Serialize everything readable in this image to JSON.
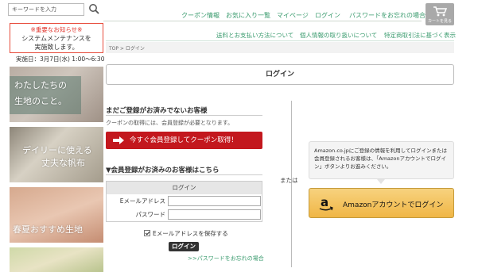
{
  "search": {
    "placeholder": "キーワードを入力"
  },
  "topnav": {
    "items": [
      "クーポン情報",
      "お気に入り一覧",
      "マイページ",
      "ログイン",
      "パスワードをお忘れの場合"
    ],
    "cart_label": "カートを見る"
  },
  "subnav": {
    "items": [
      "送料とお支払い方法について",
      "個人情報の取り扱いについて",
      "特定商取引法に基づく表示"
    ]
  },
  "breadcrumb": "TOP > ログイン",
  "notice": {
    "title": "※重要なお知らせ※",
    "line1": "システムメンテナンスを",
    "line2": "実施致します。",
    "date": "実施日：3月7日(水) 1:00〜6:30"
  },
  "banners": {
    "b1_line1": "わたしたちの",
    "b1_line2": "生地のこと。",
    "b2_line1": "デイリーに使える",
    "b2_line2": "丈夫な帆布",
    "b3_text": "春夏おすすめ生地"
  },
  "login": {
    "heading": "ログイン",
    "new_title": "まだご登録がお済みでないお客様",
    "new_desc": "クーポンの取得には、会員登録が必要となります。",
    "register_button": "今すぐ会員登録してクーポン取得！",
    "member_title": "▼会員登録がお済みのお客様はこちら",
    "form_header": "ログイン",
    "email_label": "Eメールアドレス",
    "password_label": "パスワード",
    "remember_label": "Eメールアドレスを保存する",
    "login_button": "ログイン",
    "forgot_link": ">>パスワードをお忘れの場合"
  },
  "or_text": "または",
  "amazon": {
    "info": "Amazon.co.jpにご登録の情報を利用してログインまたは会員登録されるお客様は、「Amazonアカウントでログイン」ボタンよりお進みください。",
    "button": "Amazonアカウントでログイン"
  },
  "colors": {
    "accent_green": "#3a9b6e",
    "register_red": "#c3181e",
    "amazon_yellow": "#f0b646",
    "notice_red": "#e0342c"
  }
}
